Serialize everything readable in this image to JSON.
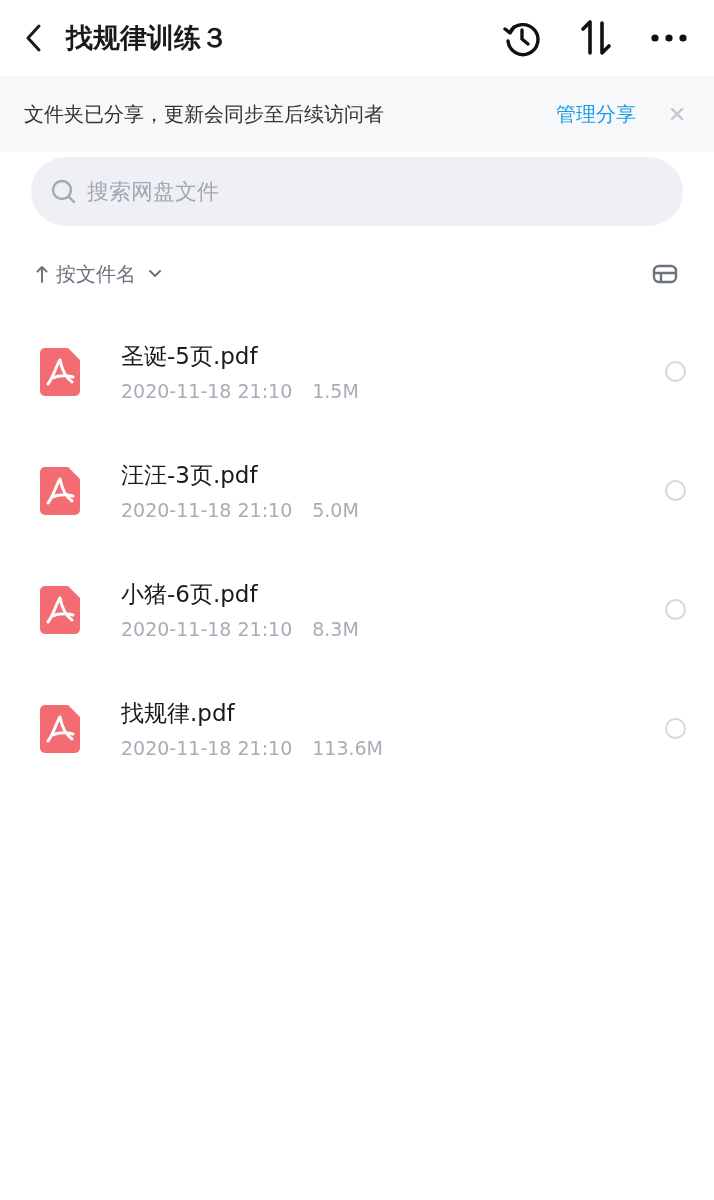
{
  "header": {
    "title": "找规律训练３"
  },
  "banner": {
    "message": "文件夹已分享，更新会同步至后续访问者",
    "action": "管理分享"
  },
  "search": {
    "placeholder": "搜索网盘文件"
  },
  "sort": {
    "label": "按文件名"
  },
  "files": [
    {
      "name": "圣诞-5页.pdf",
      "date": "2020-11-18 21:10",
      "size": "1.5M",
      "selected": false
    },
    {
      "name": "汪汪-3页.pdf",
      "date": "2020-11-18 21:10",
      "size": "5.0M",
      "selected": false
    },
    {
      "name": "小猪-6页.pdf",
      "date": "2020-11-18 21:10",
      "size": "8.3M",
      "selected": false
    },
    {
      "name": "找规律.pdf",
      "date": "2020-11-18 21:10",
      "size": "113.6M",
      "selected": false
    }
  ]
}
